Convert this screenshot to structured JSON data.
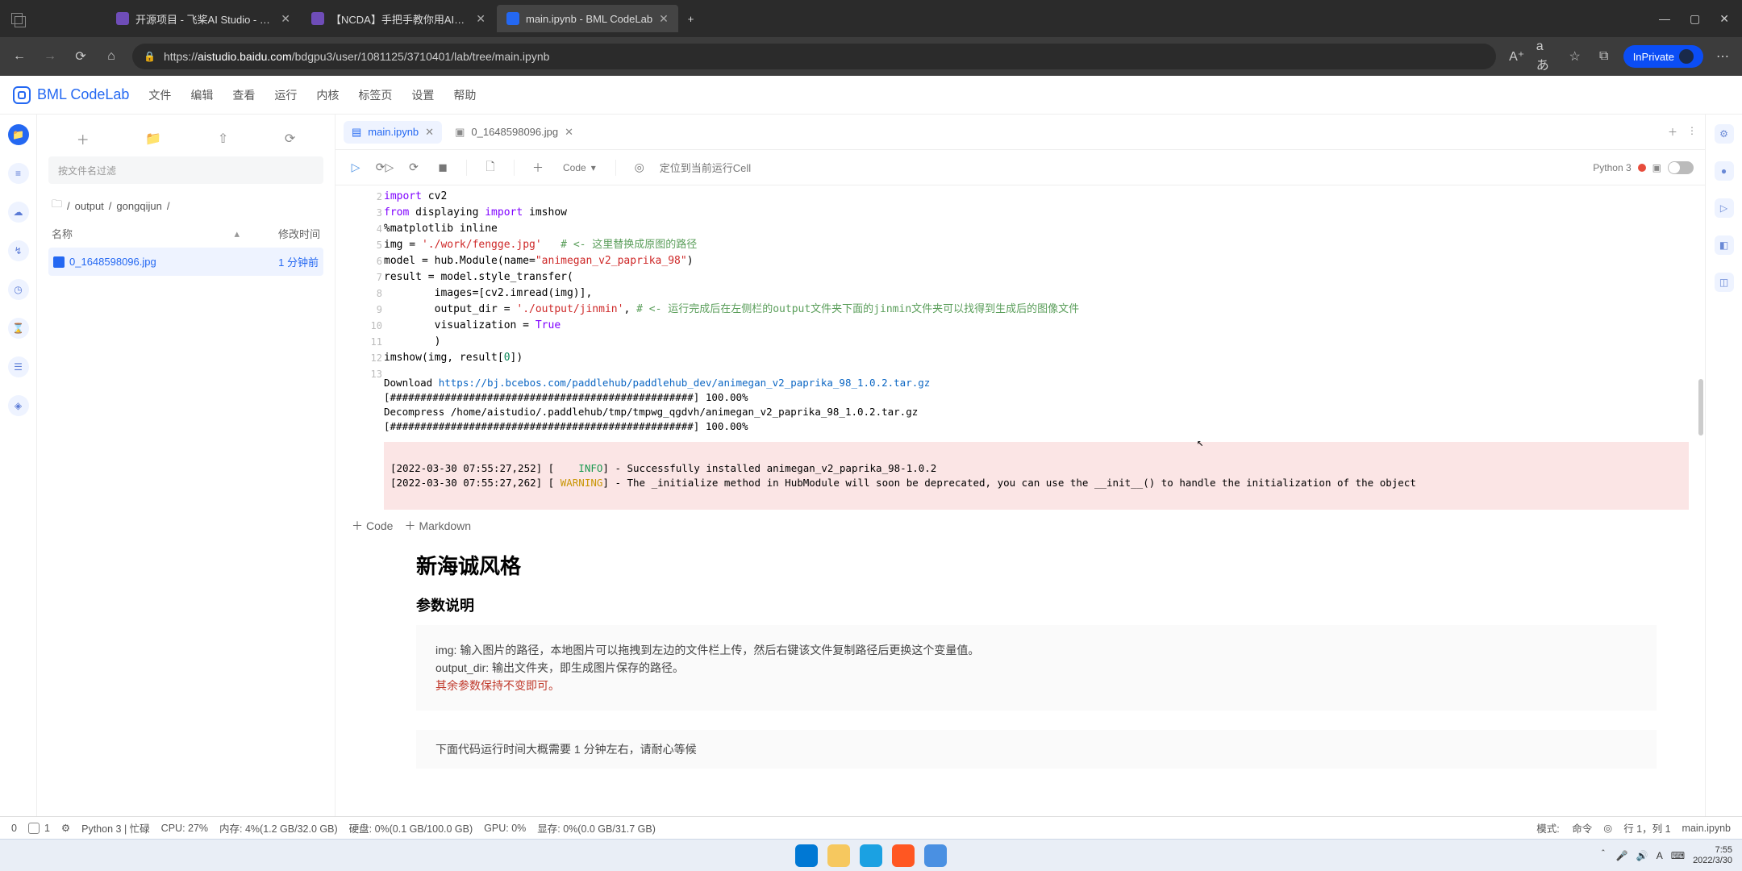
{
  "browser": {
    "tabs": [
      {
        "label": "开源项目 - 飞桨AI Studio - 人工…"
      },
      {
        "label": "【NCDA】手把手教你用AI玩转…"
      },
      {
        "label": "main.ipynb - BML CodeLab"
      }
    ],
    "new_tab": "+",
    "win": {
      "min": "—",
      "max": "▢",
      "close": "✕"
    },
    "nav": {
      "back": "←",
      "forward": "→",
      "reload": "⟳",
      "home": "⌂"
    },
    "lock": "🔒",
    "url_host": "aistudio.baidu.com",
    "url_path": "/bdgpu3/user/1081125/3710401/lab/tree/main.ipynb",
    "toolbar_icons": [
      "A⁺",
      "aあ",
      "☆",
      "⧉"
    ],
    "inprivate": "InPrivate",
    "more": "⋯"
  },
  "app": {
    "logo_text": "BML CodeLab",
    "menu": [
      "文件",
      "编辑",
      "查看",
      "运行",
      "内核",
      "标签页",
      "设置",
      "帮助"
    ]
  },
  "rail_icons": [
    "📁",
    "≡",
    "☁",
    "↯",
    "◷",
    "⌛",
    "☰",
    "◈"
  ],
  "sidebar": {
    "actions": [
      "＋",
      "📁",
      "⇧",
      "⟳"
    ],
    "filter_placeholder": "按文件名过滤",
    "crumbs": [
      "/",
      "output",
      "/",
      "gongqijun",
      "/"
    ],
    "folder_icon": "🗀",
    "col_name": "名称",
    "col_time": "修改时间",
    "sort_icon": "▾",
    "expand_icon": "▴",
    "files": [
      {
        "name": "0_1648598096.jpg",
        "time": "1 分钟前"
      }
    ]
  },
  "tabs_strip": {
    "items": [
      {
        "label": "main.ipynb",
        "active": true
      },
      {
        "label": "0_1648598096.jpg",
        "active": false
      }
    ],
    "close": "✕",
    "add": "＋",
    "more": "⋮"
  },
  "nb_toolbar": {
    "run": "▷",
    "run_restart": "⟳▷",
    "restart": "⟳",
    "stop": "◼",
    "clear": "🗋",
    "plus": "＋",
    "dropdown_label": "Code",
    "dropdown_caret": "▾",
    "locate_icon": "◎",
    "locate_label": "定位到当前运行Cell",
    "kernel": "Python 3",
    "square": "▣"
  },
  "code": {
    "gutter": [
      "3",
      "4",
      "5",
      "6",
      "7",
      "8",
      "9",
      "10",
      "11",
      "12",
      "13"
    ],
    "lines": [
      {
        "plain": "import cv2",
        "cls": "kw-first",
        "render": "<span class='kw'>import</span> cv2"
      },
      {
        "render": "<span class='kw'>from</span> displaying <span class='kw'>import</span> imshow"
      },
      {
        "render": "%matplotlib inline"
      },
      {
        "render": ""
      },
      {
        "render": "img = <span class='str'>'./work/fengge.jpg'</span>   <span class='cmt'># &lt;- 这里替换成原图的路径</span>"
      },
      {
        "render": "model = hub.Module(name=<span class='str'>\"animegan_v2_paprika_98\"</span>)"
      },
      {
        "render": "result = model.style_transfer("
      },
      {
        "render": "        images=[cv2.imread(img)],"
      },
      {
        "render": "        output_dir = <span class='str'>'./output/jinmin'</span>, <span class='cmt'># &lt;- 运行完成后在左侧栏的output文件夹下面的jinmin文件夹可以找得到生成后的图像文件</span>"
      },
      {
        "render": "        visualization = <span class='bool'>True</span>"
      },
      {
        "render": "        )"
      },
      {
        "render": "imshow(img, result[<span class='num'>0</span>])"
      }
    ]
  },
  "output": {
    "line1_pre": "Download ",
    "line1_url": "https://bj.bcebos.com/paddlehub/paddlehub_dev/animegan_v2_paprika_98_1.0.2.tar.gz",
    "line2": "[##################################################] 100.00%",
    "line3": "Decompress /home/aistudio/.paddlehub/tmp/tmpwg_qgdvh/animegan_v2_paprika_98_1.0.2.tar.gz",
    "line4": "[##################################################] 100.00%",
    "stderr1_pre": "[2022-03-30 07:55:27,252] [    ",
    "stderr1_info": "INFO",
    "stderr1_post": "] - Successfully installed animegan_v2_paprika_98-1.0.2",
    "stderr2_pre": "[2022-03-30 07:55:27,262] [ ",
    "stderr2_warn": "WARNING",
    "stderr2_post": "] - The _initialize method in HubModule will soon be deprecated, you can use the __init__() to handle the initialization of the object"
  },
  "add": {
    "code": "Code",
    "markdown": "Markdown",
    "plus": "＋"
  },
  "markdown": {
    "h2": "新海诚风格",
    "h3": "参数说明",
    "p1a": "img: 输入图片的路径，本地图片可以拖拽到左边的文件栏上传，然后右键该文件复制路径后更换这个变量值。",
    "p1b": "output_dir: 输出文件夹，即生成图片保存的路径。",
    "p1c": "其余参数保持不变即可。",
    "p2": "下面代码运行时间大概需要 1 分钟左右，请耐心等候"
  },
  "right_rail": [
    "⚙",
    "●",
    "▷",
    "◧",
    "◫"
  ],
  "status": {
    "left1": "0",
    "left2_icon": "▮",
    "left2": "1",
    "gear": "⚙",
    "kernel": "Python 3 | 忙碌",
    "cpu": "CPU:   27%",
    "mem": "内存:   4%(1.2 GB/32.0 GB)",
    "disk": "硬盘:   0%(0.1 GB/100.0 GB)",
    "gpu": "GPU:   0%",
    "gpumem": "显存:   0%(0.0 GB/31.7 GB)",
    "mode_label": "模式:",
    "mode_value": "命令",
    "ring": "◎",
    "pos": "行 1，列 1",
    "file": "main.ipynb"
  },
  "taskbar": {
    "apps_colors": [
      "#0078d4",
      "#f6c85f",
      "#1ba1e2",
      "#ff5722",
      "#4a90e2"
    ],
    "tray": [
      "＾",
      "🎤",
      "🔊",
      "A",
      "⌨"
    ],
    "time": "7:55",
    "date": "2022/3/30"
  }
}
